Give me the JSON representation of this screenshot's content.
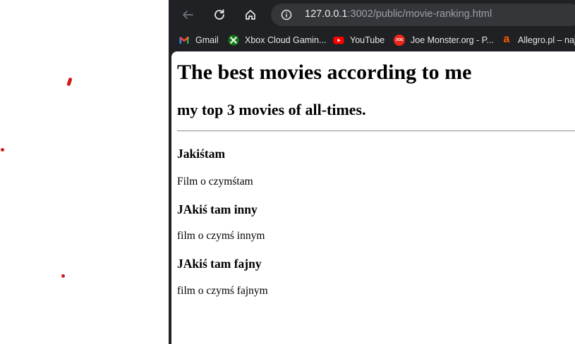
{
  "browser": {
    "url_host": "127.0.0.1",
    "url_path": ":3002/public/movie-ranking.html",
    "bookmarks": [
      {
        "label": "Gmail",
        "icon": "gmail-icon"
      },
      {
        "label": "Xbox Cloud Gamin...",
        "icon": "xbox-icon"
      },
      {
        "label": "YouTube",
        "icon": "youtube-icon"
      },
      {
        "label": "Joe Monster.org - P...",
        "icon": "joe-monster-icon",
        "icon_text": "JOE"
      },
      {
        "label": "Allegro.pl – naj",
        "icon": "allegro-icon",
        "icon_text": "a"
      }
    ],
    "colors": {
      "frame": "#202124",
      "omnibox": "#35363a",
      "text": "#e8eaed",
      "muted": "#9aa0a6"
    }
  },
  "page": {
    "heading": "The best movies according to me",
    "subheading": "my top 3 movies of all-times.",
    "movies": [
      {
        "title": "Jakiśtam",
        "description": "Film o czymśtam"
      },
      {
        "title": "JAkiś tam inny",
        "description": "film o czymś innym"
      },
      {
        "title": "JAkiś tam fajny",
        "description": "film o czymś fajnym"
      }
    ]
  },
  "background": {
    "marks_color": "#d11a1a"
  }
}
